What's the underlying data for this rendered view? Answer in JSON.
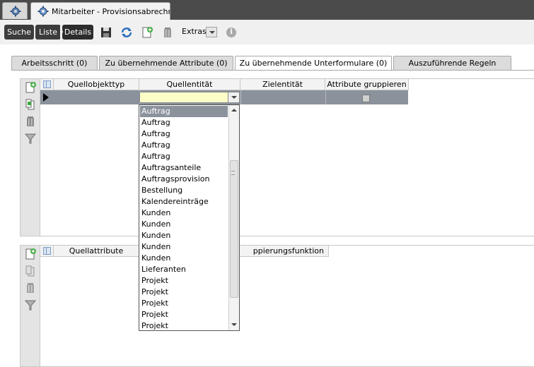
{
  "window": {
    "tab_title": "Mitarbeiter - Provisionsabrechnung"
  },
  "toolbar": {
    "breadcrumb": [
      "Suche",
      "Liste",
      "Details"
    ],
    "extras_label": "Extras",
    "info_label": "i"
  },
  "tabs": [
    {
      "label": "Arbeitsschritt (0)",
      "active": false
    },
    {
      "label": "Zu übernehmende Attribute (0)",
      "active": false
    },
    {
      "label": "Zu übernehmende Unterformulare (0)",
      "active": true
    },
    {
      "label": "Auszuführende Regeln",
      "active": false
    }
  ],
  "grid1": {
    "columns": [
      "Quellobjekttyp",
      "Quellentität",
      "Zielentität",
      "Attribute gruppieren"
    ]
  },
  "grid2": {
    "columns": [
      "Quellattribute",
      "Gruppierungsfunktion"
    ],
    "visible_column_text": [
      "Quellattribute",
      "ppierungsfunktion"
    ]
  },
  "dropdown": {
    "selected_index": 0,
    "options": [
      "Auftrag",
      "Auftrag",
      "Auftrag",
      "Auftrag",
      "Auftrag",
      "Auftragsanteile",
      "Auftragsprovision",
      "Bestellung",
      "Kalendereinträge",
      "Kunden",
      "Kunden",
      "Kunden",
      "Kunden",
      "Kunden",
      "Lieferanten",
      "Projekt",
      "Projekt",
      "Projekt",
      "Projekt",
      "Projekt"
    ]
  },
  "colors": {
    "titlebar": "#4b4b4b",
    "selected_row": "#8b929c",
    "combo_field": "#fdfdc8"
  }
}
